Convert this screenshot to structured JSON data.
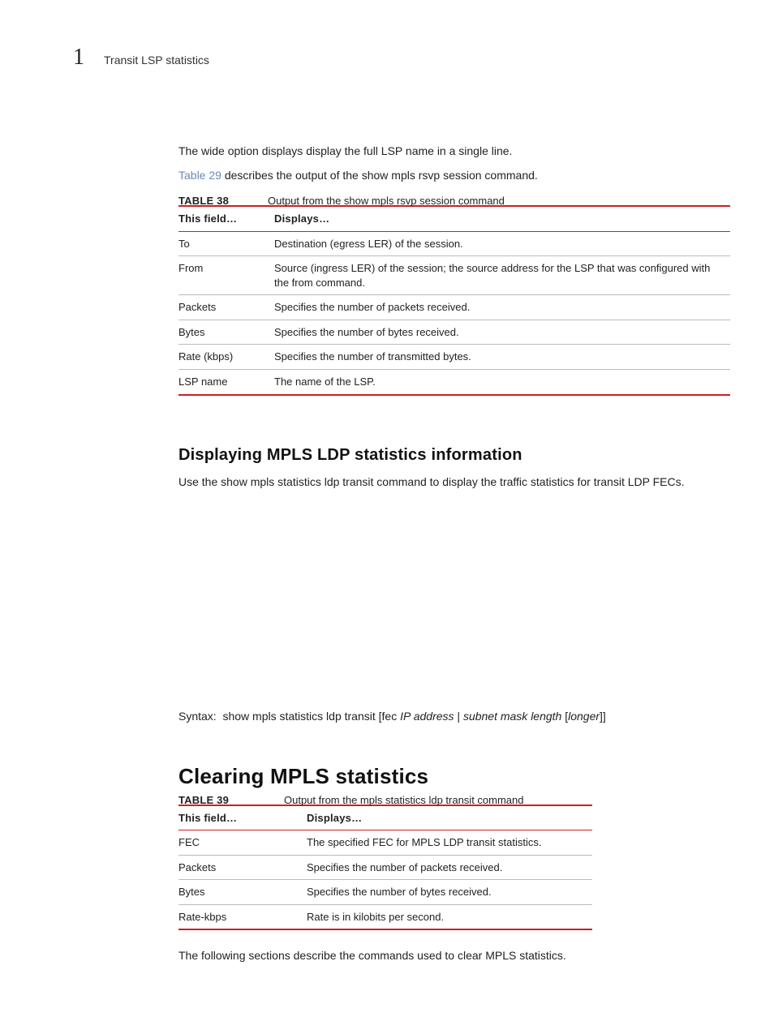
{
  "header": {
    "chapnum": "1",
    "chaptitle": "Transit LSP statistics"
  },
  "intro": {
    "p1": "The wide option displays display the full LSP name in a single line.",
    "xref": "Table 29",
    "p2_rest": " describes the output of the show mpls rsvp session command."
  },
  "table38": {
    "label": "TABLE 38",
    "title": "Output from the show mpls rsvp session command",
    "head_field": "This field…",
    "head_disp": "Displays…",
    "rows": [
      {
        "f": "To",
        "d": "Destination (egress LER) of the session."
      },
      {
        "f": "From",
        "d": "Source (ingress LER) of the session; the source address for the LSP that was configured with the from command."
      },
      {
        "f": "Packets",
        "d": "Specifies the number of packets received."
      },
      {
        "f": "Bytes",
        "d": "Specifies the number of bytes received."
      },
      {
        "f": "Rate (kbps)",
        "d": "Specifies the number of transmitted bytes."
      },
      {
        "f": "LSP name",
        "d": "The name of the LSP."
      }
    ]
  },
  "ldp": {
    "heading": "Displaying MPLS LDP statistics information",
    "para": "Use the show mpls statistics ldp transit command to display the traffic statistics for transit LDP FECs."
  },
  "syntax": {
    "lead": "Syntax:  show mpls statistics ldp transit [fec ",
    "arg1": "IP address",
    "sep": " | ",
    "arg2": "subnet mask length",
    "open": " [",
    "arg3": "longer",
    "close": "]]"
  },
  "clearing": {
    "heading": "Clearing MPLS statistics"
  },
  "table39": {
    "label": "TABLE 39",
    "title": "Output from the mpls statistics ldp transit command",
    "head_field": "This field…",
    "head_disp": "Displays…",
    "rows": [
      {
        "f": "FEC",
        "d": "The specified FEC for MPLS LDP transit statistics."
      },
      {
        "f": "Packets",
        "d": "Specifies the number of packets received."
      },
      {
        "f": "Bytes",
        "d": "Specifies the number of bytes received."
      },
      {
        "f": "Rate-kbps",
        "d": "Rate is in kilobits per second."
      }
    ]
  },
  "trailer": {
    "p": "The following sections describe the commands used to clear MPLS statistics."
  }
}
